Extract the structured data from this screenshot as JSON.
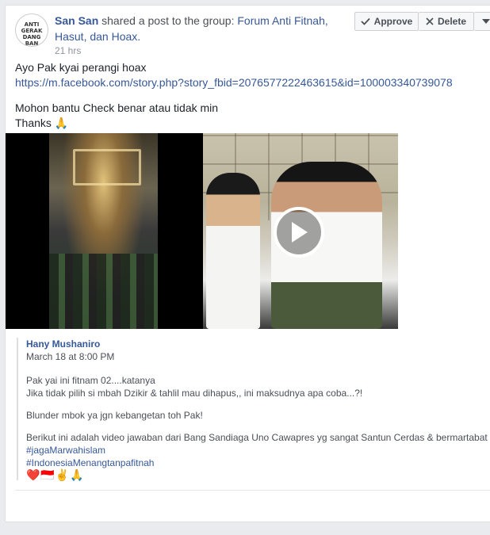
{
  "post": {
    "avatar_text": "ANTI GERAK DANG BAN",
    "author": "San San",
    "action_text": " shared a post to the group: ",
    "group_name": "Forum Anti Fitnah, Hasut, dan Hoax.",
    "timestamp": "21 hrs",
    "line1": "Ayo Pak kyai perangi hoax",
    "link": "https://m.facebook.com/story.php?story_fbid=2076577222463615&id=100003340739078",
    "line2": "Mohon bantu Check benar atau tidak min",
    "line3": "Thanks 🙏"
  },
  "actions": {
    "approve_label": "Approve",
    "delete_label": "Delete"
  },
  "shared": {
    "author": "Hany Mushaniro",
    "time": "March 18 at 8:00 PM",
    "p1_line1": "Pak yai ini fitnam 02....katanya",
    "p1_line2": "Jika tidak pilih si mbah Dzikir & tahlil mau dihapus,, ini maksudnya apa coba...?!",
    "p2": "Blunder mbok ya jgn kebangetan toh Pak!",
    "p3": "Berikut ini adalah video jawaban dari Bang Sandiaga Uno Cawapres yg sangat Santun Cerdas & bermartabat",
    "hashtag1": "#jagaMarwahislam",
    "hashtag2": "#IndonesiaMenangtanpafitnah",
    "emojis": "❤️🇮🇩✌️🙏"
  },
  "colors": {
    "link": "#365899",
    "text": "#1d2129",
    "muted": "#90949c"
  }
}
